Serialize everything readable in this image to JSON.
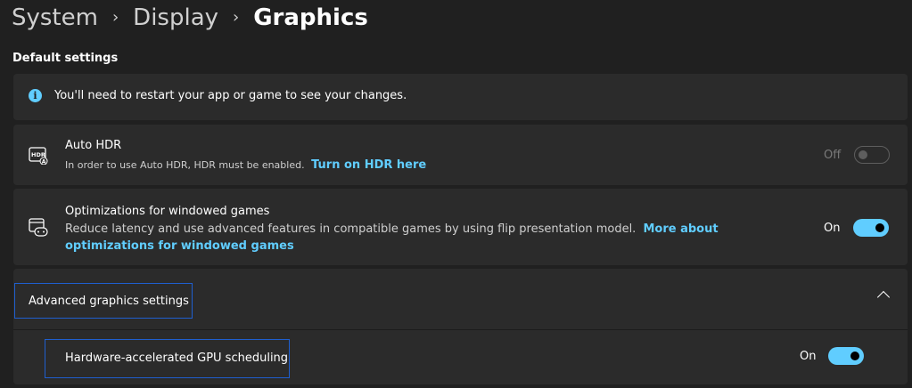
{
  "breadcrumb": {
    "items": [
      "System",
      "Display",
      "Graphics"
    ],
    "separator": "›"
  },
  "section_title": "Default settings",
  "info": {
    "text": "You'll need to restart your app or game to see your changes.",
    "icon": "info-icon"
  },
  "auto_hdr": {
    "title": "Auto HDR",
    "description": "In order to use Auto HDR, HDR must be enabled.",
    "link": "Turn on HDR here",
    "state_label": "Off",
    "enabled": false,
    "icon": "hdr-icon"
  },
  "windowed_games": {
    "title": "Optimizations for windowed games",
    "description": "Reduce latency and use advanced features in compatible games by using flip presentation model.",
    "link": "More about optimizations for windowed games",
    "state_label": "On",
    "enabled": true,
    "icon": "windowed-games-icon"
  },
  "advanced": {
    "label": "Advanced graphics settings",
    "expanded": true,
    "icon": "chevron-up-icon",
    "gpu_scheduling": {
      "label": "Hardware-accelerated GPU scheduling",
      "state_label": "On",
      "enabled": true
    }
  },
  "colors": {
    "background": "#202020",
    "card": "#2b2b2b",
    "accent": "#60cdff",
    "focus_border": "#1f5fcf"
  }
}
